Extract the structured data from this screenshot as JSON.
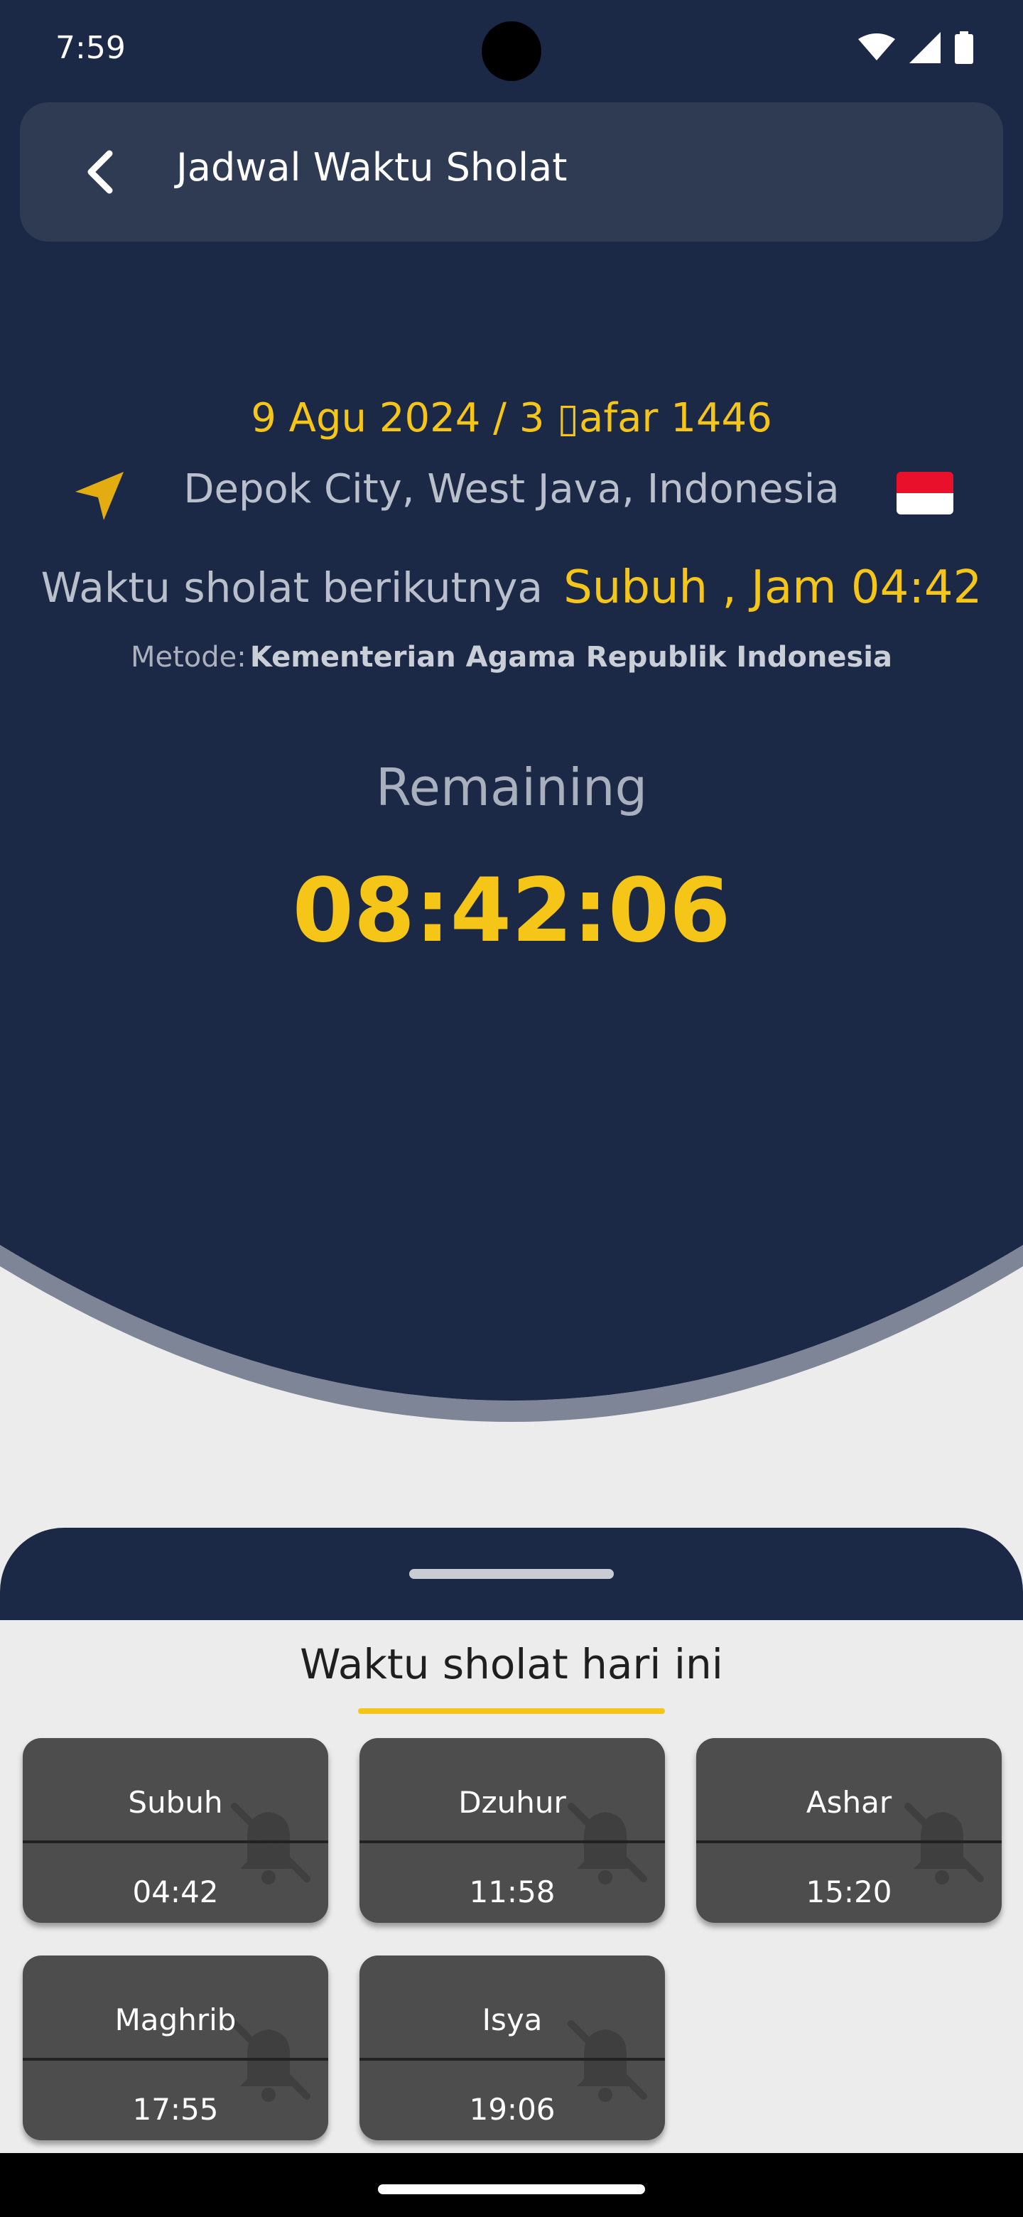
{
  "status": {
    "time": "7:59",
    "icons": [
      "wifi-icon",
      "signal-icon",
      "battery-icon"
    ]
  },
  "app_bar": {
    "title": "Jadwal Waktu Sholat",
    "back_icon": "back-arrow-icon"
  },
  "header": {
    "date": "9 Agu 2024 / 3 ▯afar 1446",
    "location": "Depok City, West Java, Indonesia",
    "location_icon": "navigation-arrow-icon",
    "flag": "indonesia-flag-icon",
    "next_prayer_label": "Waktu sholat berikutnya",
    "next_prayer_value": "Subuh , Jam 04:42",
    "method_label": "Metode:",
    "method_value": "Kementerian Agama Republik Indonesia",
    "remaining_label": "Remaining",
    "countdown": "08:42:06"
  },
  "today": {
    "title": "Waktu sholat hari ini",
    "prayers": [
      {
        "name": "Subuh",
        "time": "04:42",
        "icon": "bell-off-icon"
      },
      {
        "name": "Dzuhur",
        "time": "11:58",
        "icon": "bell-off-icon"
      },
      {
        "name": "Ashar",
        "time": "15:20",
        "icon": "bell-off-icon"
      },
      {
        "name": "Maghrib",
        "time": "17:55",
        "icon": "bell-off-icon"
      },
      {
        "name": "Isya",
        "time": "19:06",
        "icon": "bell-off-icon"
      }
    ]
  },
  "colors": {
    "navy": "#1b2846",
    "accent": "#f5c518",
    "card": "#4d4d4d",
    "background": "#ececec"
  }
}
